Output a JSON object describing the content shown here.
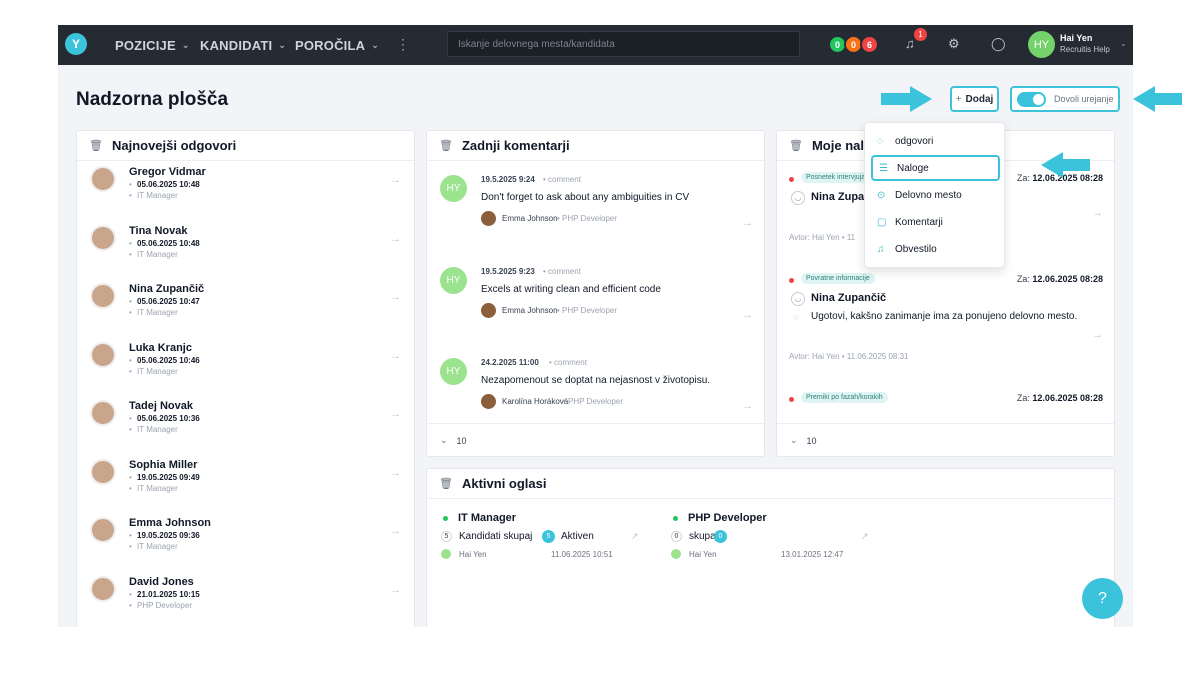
{
  "topbar": {
    "logo_glyph": "Y",
    "nav": [
      {
        "label": "POZICIJE"
      },
      {
        "label": "KANDIDATI"
      },
      {
        "label": "POROČILA"
      }
    ],
    "search_placeholder": "Iskanje delovnega mesta/kandidata",
    "status_pills": [
      {
        "value": "0",
        "color": "#22c55e"
      },
      {
        "value": "0",
        "color": "#f97316"
      },
      {
        "value": "6",
        "color": "#ef4444"
      }
    ],
    "notification_count": "1",
    "user": {
      "initials": "HY",
      "name": "Hai Yen",
      "role": "Recruitis Help"
    }
  },
  "page": {
    "title": "Nadzorna plošča",
    "add_label": "Dodaj",
    "edit_toggle_label": "Dovoli urejanje"
  },
  "responses": {
    "title": "Najnovejši odgovori",
    "items": [
      {
        "name": "Gregor Vidmar",
        "date": "05.06.2025 10:48",
        "role": "IT Manager"
      },
      {
        "name": "Tina Novak",
        "date": "05.06.2025 10:48",
        "role": "IT Manager"
      },
      {
        "name": "Nina Zupančič",
        "date": "05.06.2025 10:47",
        "role": "IT Manager"
      },
      {
        "name": "Luka Kranjc",
        "date": "05.06.2025 10:46",
        "role": "IT Manager"
      },
      {
        "name": "Tadej Novak",
        "date": "05.06.2025 10:36",
        "role": "IT Manager"
      },
      {
        "name": "Sophia Miller",
        "date": "19.05.2025 09:49",
        "role": "IT Manager"
      },
      {
        "name": "Emma Johnson",
        "date": "19.05.2025 09:36",
        "role": "IT Manager"
      },
      {
        "name": "David Jones",
        "date": "21.01.2025 10:15",
        "role": "PHP Developer"
      }
    ]
  },
  "comments": {
    "title": "Zadnji komentarji",
    "items": [
      {
        "initials": "HY",
        "date": "19.5.2025 9:24",
        "type": "comment",
        "text": "Don't forget to ask about any ambiguities in CV",
        "who": "Emma Johnson",
        "role": "PHP Developer"
      },
      {
        "initials": "HY",
        "date": "19.5.2025 9:23",
        "type": "comment",
        "text": "Excels at writing clean and efficient code",
        "who": "Emma Johnson",
        "role": "PHP Developer"
      },
      {
        "initials": "HY",
        "date": "24.2.2025 11:00",
        "type": "comment",
        "text": "Nezapomenout se doptat na nejasnost v životopisu.",
        "who": "Karolína Horáková",
        "role": "PHP Developer"
      }
    ],
    "page_size": "10"
  },
  "tasks": {
    "title": "Moje nalo",
    "items": [
      {
        "tag": "Posnetek intervjuja",
        "due_label": "Za:",
        "due": "12.06.2025 08:28",
        "person": "Nina Zupan",
        "desc": "",
        "author": "Avtor: Hai Yen",
        "created": "11"
      },
      {
        "tag": "Povratne informacije",
        "due_label": "Za:",
        "due": "12.06.2025 08:28",
        "person": "Nina Zupančič",
        "desc": "Ugotovi, kakšno zanimanje ima za ponujeno delovno mesto.",
        "author": "Avtor: Hai Yen",
        "created": "11.06.2025 08:31"
      },
      {
        "tag": "Premiki po fazah/korakih",
        "due_label": "Za:",
        "due": "12.06.2025 08:28"
      }
    ],
    "page_size": "10"
  },
  "add_menu": {
    "items": [
      {
        "label": "odgovori",
        "icon": "speech-bubble-icon"
      },
      {
        "label": "Naloge",
        "icon": "task-list-icon"
      },
      {
        "label": "Delovno mesto",
        "icon": "position-icon"
      },
      {
        "label": "Komentarji",
        "icon": "comments-icon"
      },
      {
        "label": "Obvestilo",
        "icon": "bell-icon"
      }
    ]
  },
  "ads": {
    "title": "Aktivni oglasi",
    "items": [
      {
        "name": "IT Manager",
        "count": "5",
        "count_label": "Kandidati skupaj",
        "active_count": "5",
        "active_label": "Aktiven",
        "owner": "Hai Yen",
        "date": "11.06.2025 10:51"
      },
      {
        "name": "PHP Developer",
        "count": "0",
        "count_label": "skupaj",
        "active_count": "0",
        "active_label": "",
        "owner": "Hai Yen",
        "date": "13.01.2025 12:47"
      }
    ]
  },
  "help": {
    "glyph": "?"
  },
  "colors": {
    "accent": "#3cc3dc",
    "topbar": "#252a33",
    "danger": "#ef4444",
    "success": "#22c55e"
  }
}
